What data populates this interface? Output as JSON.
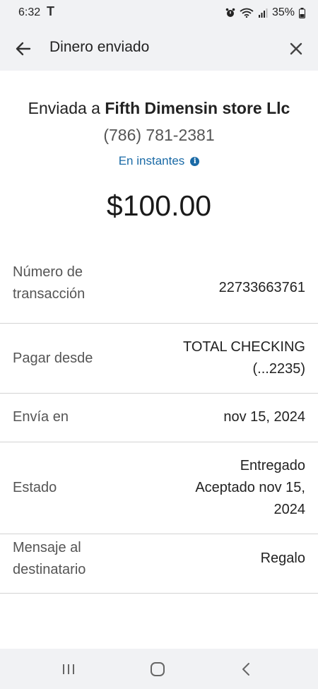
{
  "status_bar": {
    "time": "6:32",
    "carrier": "T",
    "battery": "35%",
    "icons": [
      "alarm-icon",
      "wifi-icon",
      "signal-icon",
      "battery-icon"
    ]
  },
  "app_bar": {
    "title": "Dinero enviado",
    "back_icon": "arrow-left-icon",
    "close_icon": "close-icon"
  },
  "summary": {
    "sent_prefix": "Enviada a ",
    "recipient": "Fifth Dimensin store Llc",
    "phone": "(786) 781-2381",
    "delivery_speed": "En instantes",
    "info_icon": "info-icon",
    "amount": "$100.00"
  },
  "details": {
    "transaction_number": {
      "label_line1": "Número de",
      "label_line2": "transacción",
      "value": "22733663761"
    },
    "pay_from": {
      "label": "Pagar desde",
      "value_line1": "TOTAL CHECKING",
      "value_line2": "(...2235)"
    },
    "send_on": {
      "label": "Envía en",
      "value": "nov 15, 2024"
    },
    "status": {
      "label": "Estado",
      "value_line1": "Entregado",
      "value_line2": "Aceptado nov 15,",
      "value_line3": "2024"
    },
    "message": {
      "label_line1": "Mensaje al",
      "label_line2": "destinatario",
      "value": "Regalo"
    }
  },
  "colors": {
    "accent": "#1a6aa6",
    "bar_background": "#f1f2f4",
    "divider": "#d3d3d3"
  },
  "nav_bar": {
    "icons": [
      "recent-apps-icon",
      "home-icon",
      "back-icon"
    ]
  }
}
